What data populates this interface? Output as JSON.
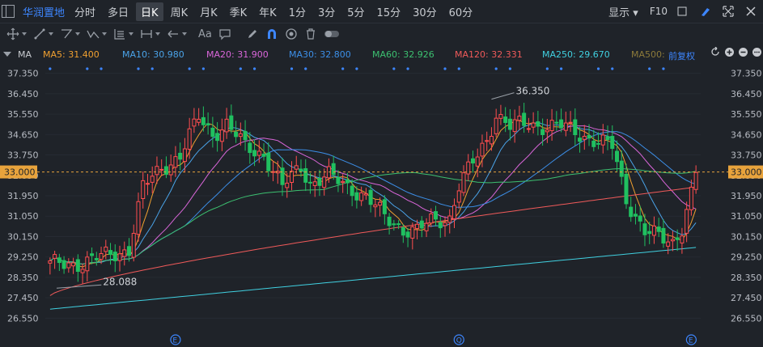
{
  "header": {
    "stock_name": "华润置地",
    "period_tabs": [
      "分时",
      "多日",
      "日K",
      "周K",
      "月K",
      "季K",
      "年K",
      "1分",
      "3分",
      "5分",
      "15分",
      "30分",
      "60分"
    ],
    "active_tab": "日K",
    "display_label": "显示",
    "f10_label": "F10"
  },
  "toolbar": {
    "text_tool_label": "Aa",
    "icons": [
      "crosshair-icon",
      "line-icon",
      "polyline-icon",
      "wave-icon",
      "fibonacci-icon",
      "range-icon",
      "arrow-icon",
      "text-icon",
      "comment-icon",
      "pen-icon",
      "magnet-icon",
      "eye-icon",
      "trash-icon",
      "toggle-icon"
    ]
  },
  "ma_bar": {
    "title": "MA",
    "items": [
      {
        "label": "MA5: 31.400",
        "color": "#f0a030"
      },
      {
        "label": "MA10: 30.980",
        "color": "#4aa3e8"
      },
      {
        "label": "MA20: 31.900",
        "color": "#d966d9"
      },
      {
        "label": "MA30: 32.800",
        "color": "#3c8fe8"
      },
      {
        "label": "MA60: 32.926",
        "color": "#3cc070"
      },
      {
        "label": "MA120: 32.331",
        "color": "#f05a5a"
      },
      {
        "label": "MA250: 29.670",
        "color": "#40d0e0"
      },
      {
        "label": "MA500:",
        "color": "#8c7a3a"
      }
    ],
    "adjust_label": "前复权"
  },
  "chart_data": {
    "type": "candlestick",
    "ylim": [
      26.1,
      37.8
    ],
    "y_ticks": [
      "37.350",
      "36.450",
      "35.550",
      "34.650",
      "33.750",
      "32.850",
      "31.950",
      "31.050",
      "30.150",
      "29.250",
      "28.350",
      "27.450",
      "26.550"
    ],
    "current_price": "33.000",
    "annotations": [
      {
        "text": "36.350",
        "price": 36.35,
        "candle": 95
      },
      {
        "text": "28.088",
        "price": 28.088,
        "candle": 10
      }
    ],
    "event_markers": [
      {
        "label": "E",
        "candle": 27
      },
      {
        "label": "Q",
        "candle": 88
      },
      {
        "label": "E",
        "candle": 138
      }
    ],
    "colors": {
      "up": "#ff4d4f",
      "down": "#20c060",
      "price_line": "#e8a33c"
    },
    "close_keypoints": [
      [
        0,
        28.9
      ],
      [
        7,
        29.0
      ],
      [
        12,
        29.3
      ],
      [
        17,
        29.6
      ],
      [
        20,
        32.3
      ],
      [
        24,
        33.2
      ],
      [
        28,
        33.7
      ],
      [
        32,
        35.4
      ],
      [
        35,
        34.7
      ],
      [
        38,
        35.1
      ],
      [
        42,
        34.1
      ],
      [
        46,
        33.8
      ],
      [
        50,
        32.3
      ],
      [
        54,
        33.3
      ],
      [
        56,
        32.5
      ],
      [
        60,
        32.8
      ],
      [
        64,
        32.4
      ],
      [
        68,
        31.9
      ],
      [
        72,
        31.0
      ],
      [
        76,
        30.5
      ],
      [
        79,
        30.4
      ],
      [
        82,
        30.8
      ],
      [
        86,
        31.0
      ],
      [
        88,
        32.4
      ],
      [
        92,
        33.7
      ],
      [
        94,
        34.4
      ],
      [
        96,
        35.6
      ],
      [
        99,
        35.0
      ],
      [
        103,
        35.1
      ],
      [
        110,
        35.0
      ],
      [
        115,
        34.6
      ],
      [
        121,
        34.1
      ],
      [
        124,
        31.8
      ],
      [
        128,
        30.4
      ],
      [
        132,
        30.0
      ],
      [
        134,
        29.9
      ],
      [
        136,
        30.6
      ],
      [
        138,
        32.1
      ],
      [
        139,
        33.0
      ]
    ]
  }
}
